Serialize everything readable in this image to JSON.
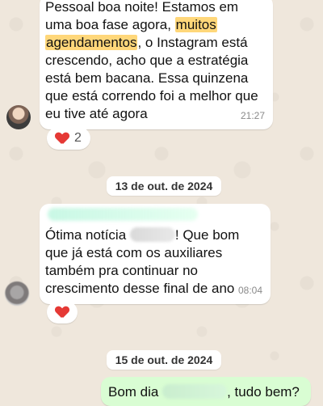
{
  "conversation": {
    "msg1": {
      "text_before_highlight_1": "Pessoal boa noite! Estamos em uma boa fase agora, ",
      "highlight_1": "muitos",
      "highlight_2": "agendamentos",
      "text_after_highlight": ", o Instagram está crescendo, acho que a estratégia está bem bacana.  Essa quinzena que está correndo foi a melhor que eu tive até agora",
      "time": "21:27",
      "reaction_count": "2"
    },
    "date_1": "13 de out. de 2024",
    "msg2": {
      "text_start": "Ótima notícia",
      "text_end": "! Que bom que já está com os auxiliares também pra continuar no crescimento desse final de ano",
      "time": "08:04"
    },
    "date_2": "15 de out. de 2024",
    "msg3": {
      "text_start": "Bom dia",
      "text_end": ", tudo bem?"
    }
  },
  "colors": {
    "chat_background": "#efe7dc",
    "incoming_bubble": "#ffffff",
    "outgoing_bubble": "#d9fdd3",
    "highlight": "#ffd77a",
    "reaction_heart": "#e53935"
  },
  "icons": {
    "reaction": "heart-icon"
  }
}
